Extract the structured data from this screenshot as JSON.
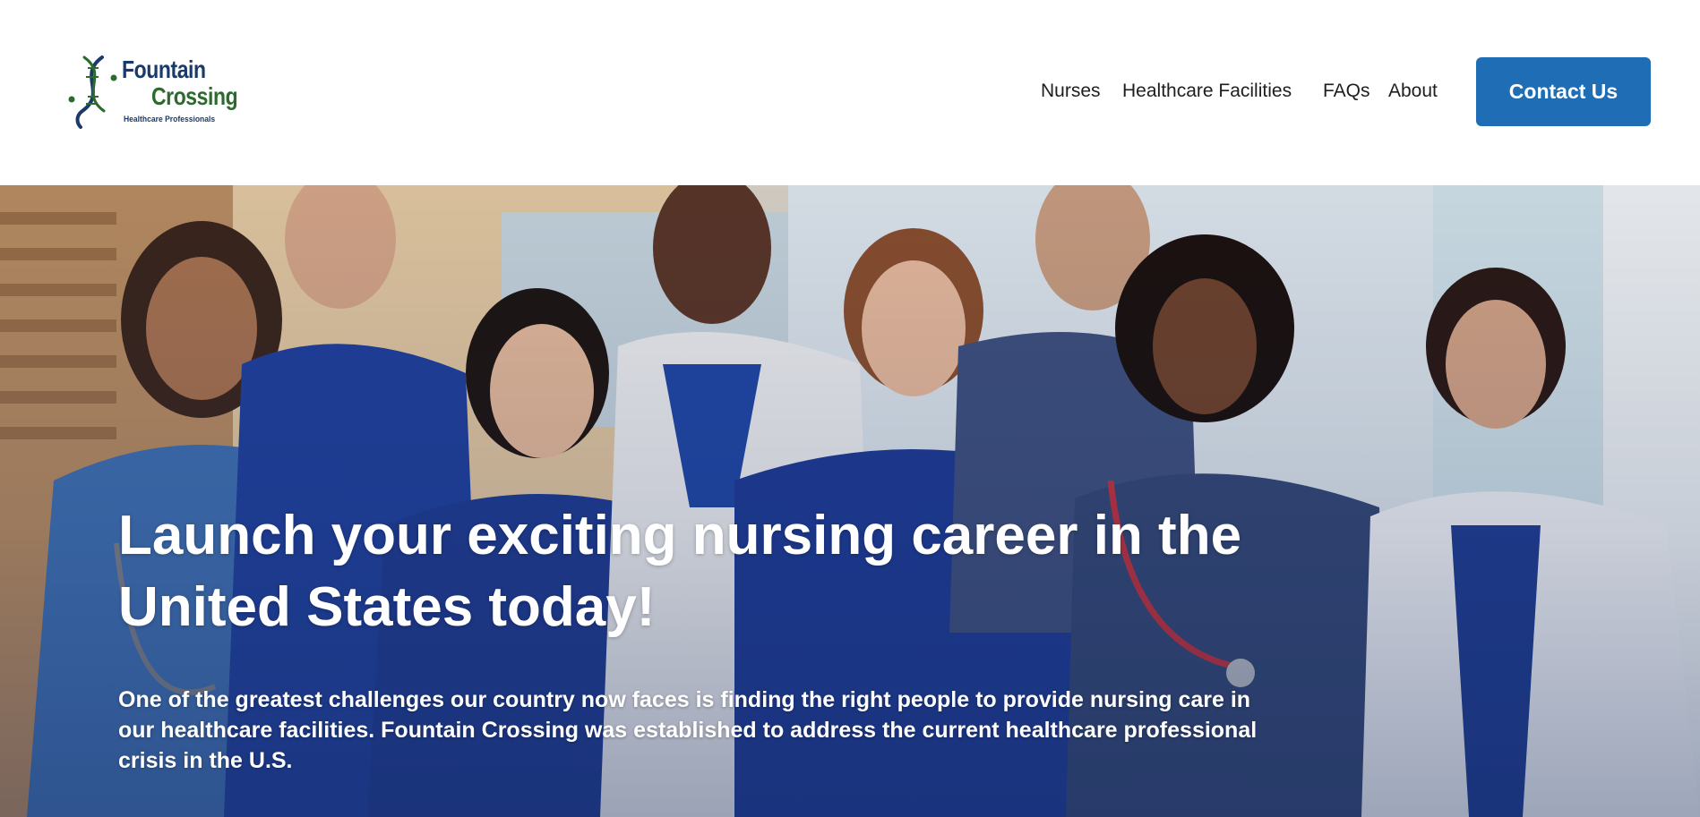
{
  "logo": {
    "line1": "Fountain",
    "line2": "Crossing",
    "tagline": "Healthcare Professionals",
    "colors": {
      "primary": "#1a3a6b",
      "secondary": "#2d6a2e"
    }
  },
  "nav": {
    "items": [
      {
        "label": "Nurses"
      },
      {
        "label": "Healthcare Facilities"
      },
      {
        "label": "FAQs"
      },
      {
        "label": "About"
      }
    ],
    "cta_label": "Contact Us"
  },
  "hero": {
    "title": "Launch your exciting nursing career in the United States today!",
    "body": "One of the greatest challenges our country now faces is finding the right people to provide nursing care in our healthcare facilities. Fountain Crossing was established to address the current healthcare professional crisis in the U.S."
  },
  "colors": {
    "accent": "#1f6eb5",
    "text": "#1e1e1e"
  }
}
